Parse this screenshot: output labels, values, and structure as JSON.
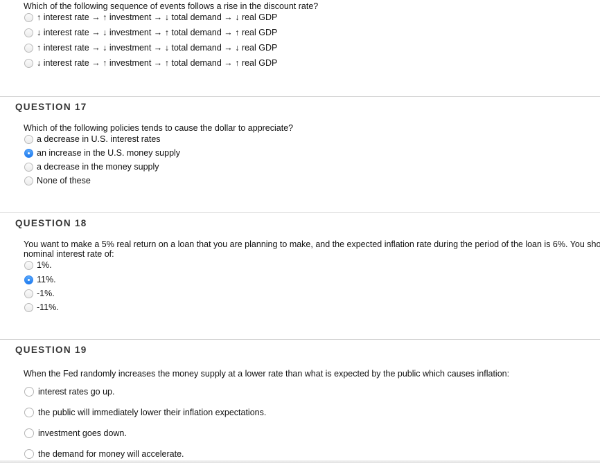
{
  "questions": [
    {
      "id": "q16",
      "header": "",
      "text": "Which of the following sequence of events follows a rise in the discount rate?",
      "options": [
        {
          "label": "↑ interest rate → ↑ investment → ↓ total demand → ↓ real GDP",
          "selected": false
        },
        {
          "label": "↓ interest rate → ↓ investment → ↑ total demand → ↑ real GDP",
          "selected": false
        },
        {
          "label": "↑ interest rate → ↓ investment → ↓ total demand → ↓ real GDP",
          "selected": false
        },
        {
          "label": "↓ interest rate → ↑ investment → ↑ total demand → ↑ real GDP",
          "selected": false
        }
      ]
    },
    {
      "id": "q17",
      "header": "QUESTION 17",
      "text": "Which of the following policies tends to cause the dollar to appreciate?",
      "options": [
        {
          "label": "a decrease in U.S. interest rates",
          "selected": false
        },
        {
          "label": "an increase in the U.S. money supply",
          "selected": true
        },
        {
          "label": "a decrease in the money supply",
          "selected": false
        },
        {
          "label": "None of these",
          "selected": false
        }
      ]
    },
    {
      "id": "q18",
      "header": "QUESTION 18",
      "text_line1": "You want to make a 5% real return on a loan that you are planning to make, and the expected inflation rate during the period of the loan is 6%. You should charge a",
      "text_line2": "nominal interest rate of:",
      "options": [
        {
          "label": "1%.",
          "selected": false
        },
        {
          "label": "11%.",
          "selected": true
        },
        {
          "label": "-1%.",
          "selected": false
        },
        {
          "label": "-11%.",
          "selected": false
        }
      ]
    },
    {
      "id": "q19",
      "header": "QUESTION 19",
      "text": "When the Fed randomly increases the money supply at a lower rate than what is expected by the public which causes inflation:",
      "options": [
        {
          "label": "interest rates go up.",
          "selected": false
        },
        {
          "label": "the public will immediately lower their inflation expectations.",
          "selected": false
        },
        {
          "label": "investment goes down.",
          "selected": false
        },
        {
          "label": "the demand for money will accelerate.",
          "selected": false
        }
      ]
    }
  ],
  "colors": {
    "radio_selected": "#1f7cf0",
    "divider": "#d5d5d5",
    "header_text": "#333333"
  }
}
